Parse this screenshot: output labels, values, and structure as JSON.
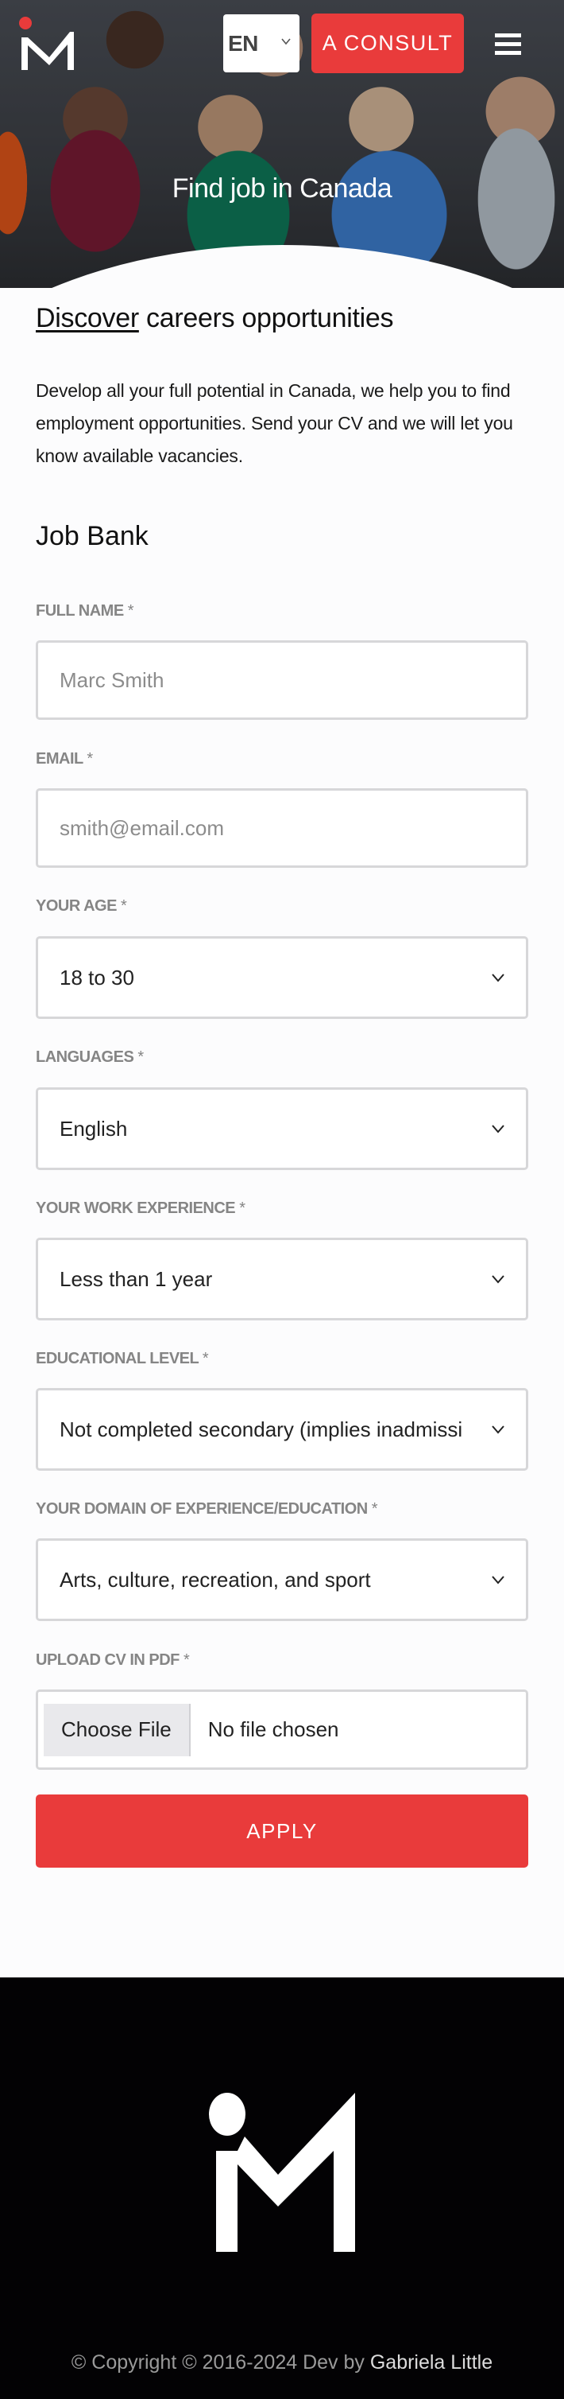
{
  "header": {
    "logo_alt": "IM logo",
    "language": "EN",
    "consult_label": "A CONSULT",
    "hero_title": "Find job in Canada"
  },
  "intro": {
    "heading_emphasis": "Discover",
    "heading_rest": " careers opportunities",
    "paragraph": "Develop all your full potential in Canada, we help you to find employment opportunities. Send your CV and we will let you know available vacancies."
  },
  "form": {
    "title": "Job Bank",
    "required_mark": "*",
    "fields": [
      {
        "label": "FULL NAME",
        "type": "text",
        "placeholder": "Marc Smith",
        "value": ""
      },
      {
        "label": "EMAIL",
        "type": "email",
        "placeholder": "smith@email.com",
        "value": ""
      },
      {
        "label": "YOUR AGE",
        "type": "select",
        "value": "18 to 30"
      },
      {
        "label": "LANGUAGES",
        "type": "select",
        "value": "English"
      },
      {
        "label": "YOUR WORK EXPERIENCE",
        "type": "select",
        "value": "Less than 1 year"
      },
      {
        "label": "EDUCATIONAL LEVEL",
        "type": "select",
        "value": "Not completed secondary (implies inadmissi"
      },
      {
        "label": "YOUR DOMAIN OF EXPERIENCE/EDUCATION",
        "type": "select",
        "value": "Arts, culture, recreation, and sport"
      },
      {
        "label": "UPLOAD CV IN PDF",
        "type": "file",
        "button_label": "Choose File",
        "status": "No file chosen"
      }
    ],
    "submit_label": "APPLY"
  },
  "footer": {
    "copyright_text": "© Copyright © 2016-2024 Dev by ",
    "author": "Gabriela Little"
  },
  "colors": {
    "accent": "#e93b3b",
    "label": "#858585",
    "footer_bg": "#030204"
  }
}
